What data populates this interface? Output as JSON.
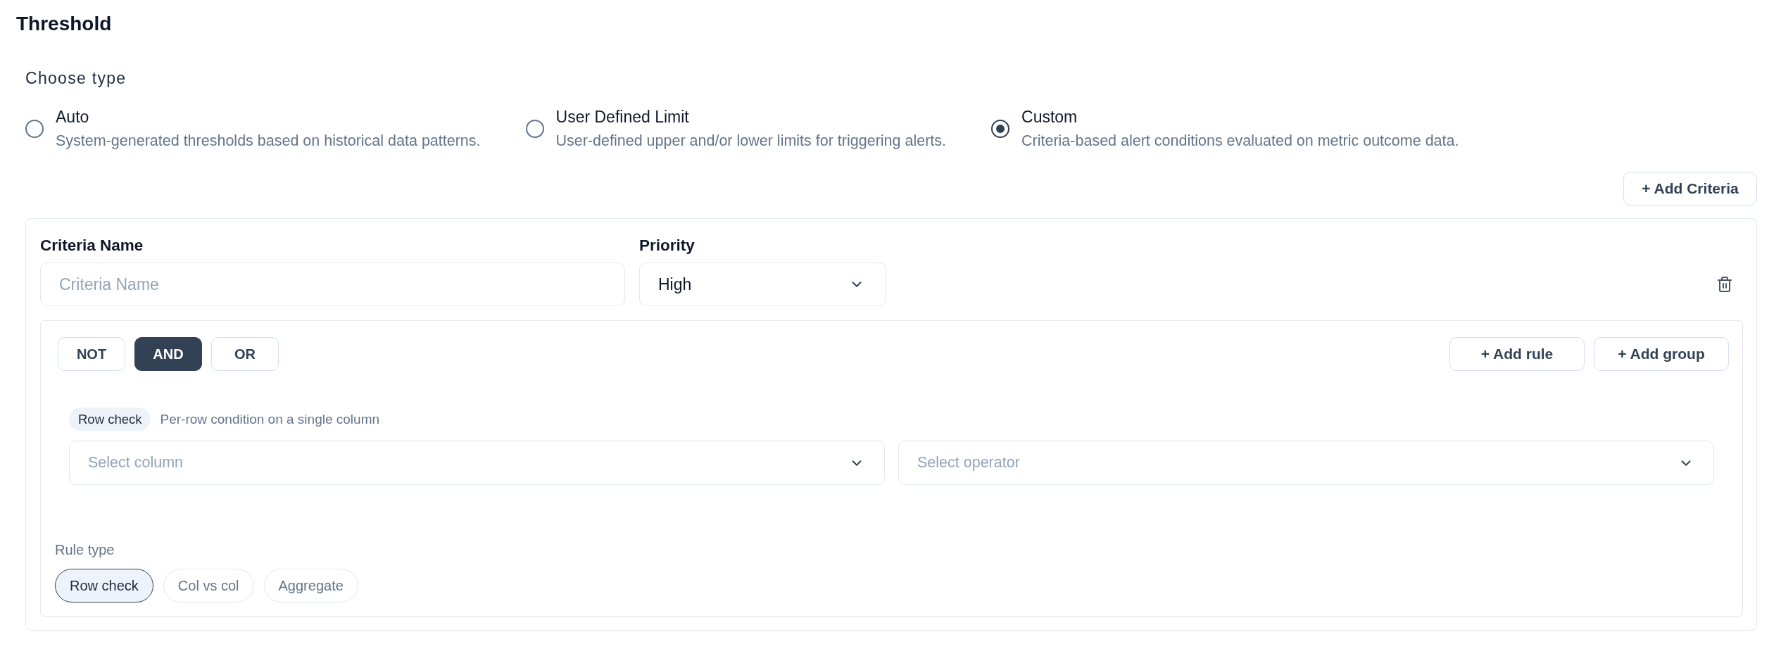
{
  "title": "Threshold",
  "type_picker": {
    "label": "Choose type",
    "options": [
      {
        "label": "Auto",
        "description": "System-generated thresholds based on historical data patterns.",
        "selected": false
      },
      {
        "label": "User Defined Limit",
        "description": "User-defined upper and/or lower limits for triggering alerts.",
        "selected": false
      },
      {
        "label": "Custom",
        "description": "Criteria-based alert conditions evaluated on metric outcome data.",
        "selected": true
      }
    ]
  },
  "add_criteria_button": "+ Add Criteria",
  "criteria": [
    {
      "name_field": {
        "label": "Criteria Name",
        "placeholder": "Criteria Name"
      },
      "priority": {
        "label": "Priority",
        "value": "High"
      },
      "group": {
        "operators": [
          {
            "label": "NOT",
            "selected": false
          },
          {
            "label": "AND",
            "selected": true
          },
          {
            "label": "OR",
            "selected": false
          }
        ],
        "actions": [
          "+ Add rule",
          "+ Add group"
        ],
        "rules": [
          {
            "badge": "Row check",
            "hint": "Per-row condition on a single column",
            "column_select": {
              "placeholder": "Select column"
            },
            "operator_select": {
              "placeholder": "Select operator"
            }
          }
        ],
        "rule_type": {
          "label": "Rule type",
          "options": [
            {
              "label": "Row check",
              "selected": true
            },
            {
              "label": "Col vs col",
              "selected": false
            },
            {
              "label": "Aggregate",
              "selected": false
            }
          ]
        }
      }
    }
  ]
}
